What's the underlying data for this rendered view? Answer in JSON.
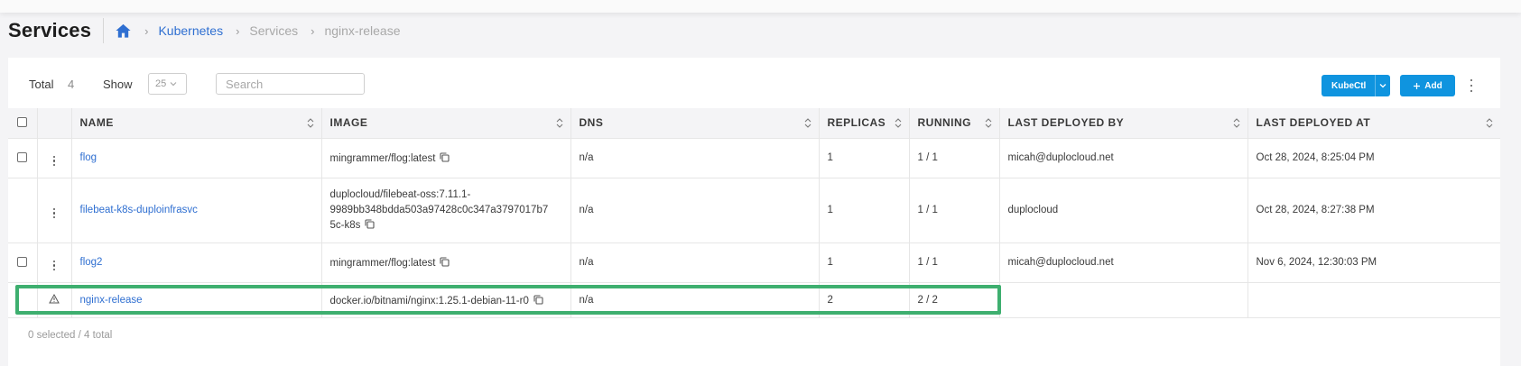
{
  "page": {
    "title": "Services",
    "breadcrumb": [
      "Kubernetes",
      "Services",
      "nginx-release"
    ]
  },
  "toolbar": {
    "total_label": "Total",
    "total_value": "4",
    "show_label": "Show",
    "show_value": "25",
    "search_placeholder": "Search",
    "kubectl_label": "KubeCtl",
    "add_label": "Add"
  },
  "table": {
    "columns": [
      "NAME",
      "IMAGE",
      "DNS",
      "REPLICAS",
      "RUNNING",
      "LAST DEPLOYED BY",
      "LAST DEPLOYED AT"
    ],
    "rows": [
      {
        "name": "flog",
        "image": "mingrammer/flog:latest",
        "dns": "n/a",
        "replicas": "1",
        "running": "1 / 1",
        "deployed_by": "micah@duplocloud.net",
        "deployed_at": "Oct 28, 2024, 8:25:04 PM",
        "has_checkbox": true,
        "warning": false
      },
      {
        "name": "filebeat-k8s-duploinfrasvc",
        "image_lines": [
          "duplocloud/filebeat-oss:7.11.1-",
          "9989bb348bdda503a97428c0c347a3797017b7",
          "5c-k8s"
        ],
        "dns": "n/a",
        "replicas": "1",
        "running": "1 / 1",
        "deployed_by": "duplocloud",
        "deployed_at": "Oct 28, 2024, 8:27:38 PM",
        "has_checkbox": false,
        "warning": false
      },
      {
        "name": "flog2",
        "image": "mingrammer/flog:latest",
        "dns": "n/a",
        "replicas": "1",
        "running": "1 / 1",
        "deployed_by": "micah@duplocloud.net",
        "deployed_at": "Nov 6, 2024, 12:30:03 PM",
        "has_checkbox": true,
        "warning": false
      },
      {
        "name": "nginx-release",
        "image": "docker.io/bitnami/nginx:1.25.1-debian-11-r0",
        "dns": "n/a",
        "replicas": "2",
        "running": "2 / 2",
        "deployed_by": "",
        "deployed_at": "",
        "has_checkbox": false,
        "warning": true
      }
    ]
  },
  "footer": {
    "selection_text": "0 selected / 4 total"
  },
  "colors": {
    "accent": "#0f94df",
    "link": "#2f6fd1",
    "highlight": "#3eaf6f"
  },
  "icons": [
    "home-icon",
    "chevron-right-icon",
    "chevron-down-icon",
    "plus-icon",
    "kebab-menu-icon",
    "sort-icon",
    "copy-icon",
    "warning-icon"
  ]
}
